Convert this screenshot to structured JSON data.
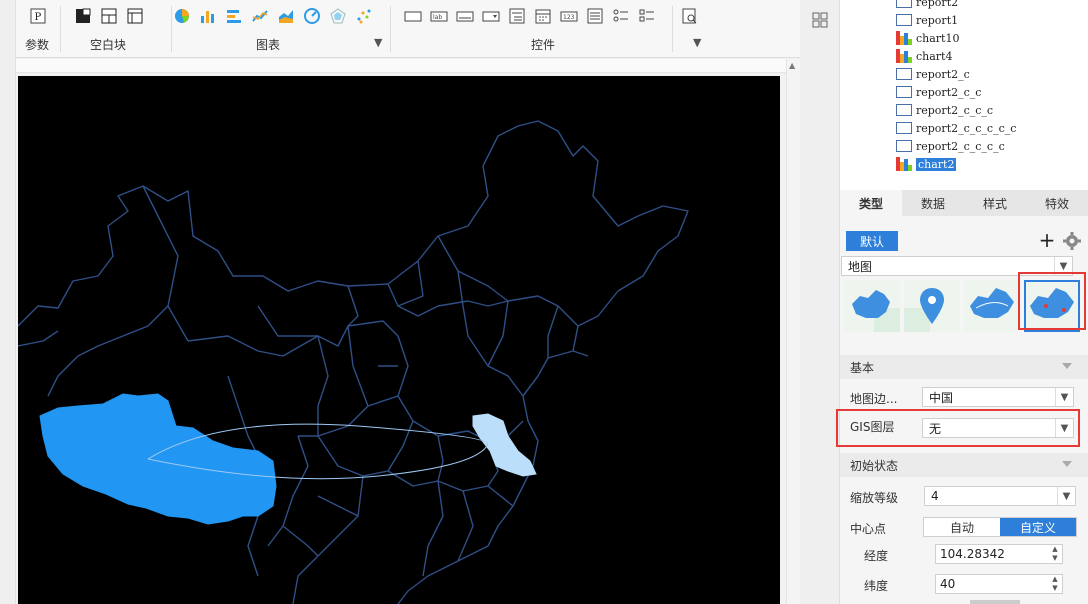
{
  "toolbar": {
    "param_label": "参数",
    "blank_label": "空白块",
    "chart_label": "图表",
    "widget_label": "控件"
  },
  "tree": {
    "items": [
      {
        "label": "report2",
        "type": "report"
      },
      {
        "label": "report1",
        "type": "report"
      },
      {
        "label": "chart10",
        "type": "chart"
      },
      {
        "label": "chart4",
        "type": "chart"
      },
      {
        "label": "report2_c",
        "type": "report"
      },
      {
        "label": "report2_c_c",
        "type": "report"
      },
      {
        "label": "report2_c_c_c",
        "type": "report"
      },
      {
        "label": "report2_c_c_c_c_c",
        "type": "report"
      },
      {
        "label": "report2_c_c_c_c",
        "type": "report"
      },
      {
        "label": "chart2",
        "type": "chart",
        "selected": true
      }
    ]
  },
  "tabs": [
    "类型",
    "数据",
    "样式",
    "特效"
  ],
  "type_panel": {
    "default_button": "默认",
    "chart_type": "地图"
  },
  "sections": {
    "basic": "基本",
    "initial": "初始状态"
  },
  "fields": {
    "map_border_label": "地图边...",
    "map_border_value": "中国",
    "gis_label": "GIS图层",
    "gis_value": "无",
    "zoom_label": "缩放等级",
    "zoom_value": "4",
    "center_label": "中心点",
    "center_auto": "自动",
    "center_custom": "自定义",
    "lng_label": "经度",
    "lng_value": "104.28342",
    "lat_label": "纬度",
    "lat_value": "40"
  },
  "colors": {
    "accent": "#2e7fd9",
    "highlight_red": "#e53935",
    "map_outline": "#2f4f86",
    "map_fill_tibet": "#2196f3",
    "map_fill_jiangsu": "#bbdefb",
    "canvas_bg": "#000000"
  }
}
